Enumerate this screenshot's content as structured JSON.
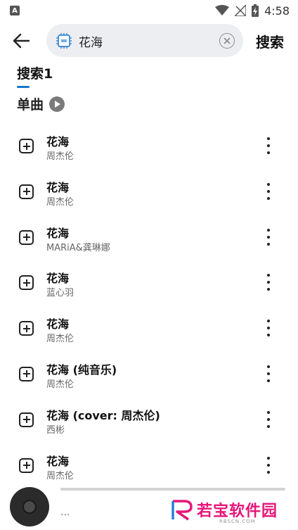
{
  "status_bar": {
    "notification_letter": "A",
    "time": "4:58"
  },
  "search": {
    "query": "花海",
    "action_label": "搜索"
  },
  "tab": {
    "label": "搜索1"
  },
  "section": {
    "title": "单曲"
  },
  "songs": [
    {
      "title": "花海",
      "artist": "周杰伦"
    },
    {
      "title": "花海",
      "artist": "周杰伦"
    },
    {
      "title": "花海",
      "artist": "MARiA&龚琳娜"
    },
    {
      "title": "花海",
      "artist": "蓝心羽"
    },
    {
      "title": "花海",
      "artist": "周杰伦"
    },
    {
      "title": "花海 (纯音乐)",
      "artist": "周杰伦"
    },
    {
      "title": "花海 (cover: 周杰伦)",
      "artist": "西彬"
    },
    {
      "title": "花海",
      "artist": "周杰伦"
    }
  ],
  "player": {
    "now_playing": "..."
  },
  "watermark": {
    "brand": "若宝软件园",
    "site": "RBSCN.COM"
  },
  "colors": {
    "accent": "#1976d2",
    "watermark": "#e6167a"
  }
}
